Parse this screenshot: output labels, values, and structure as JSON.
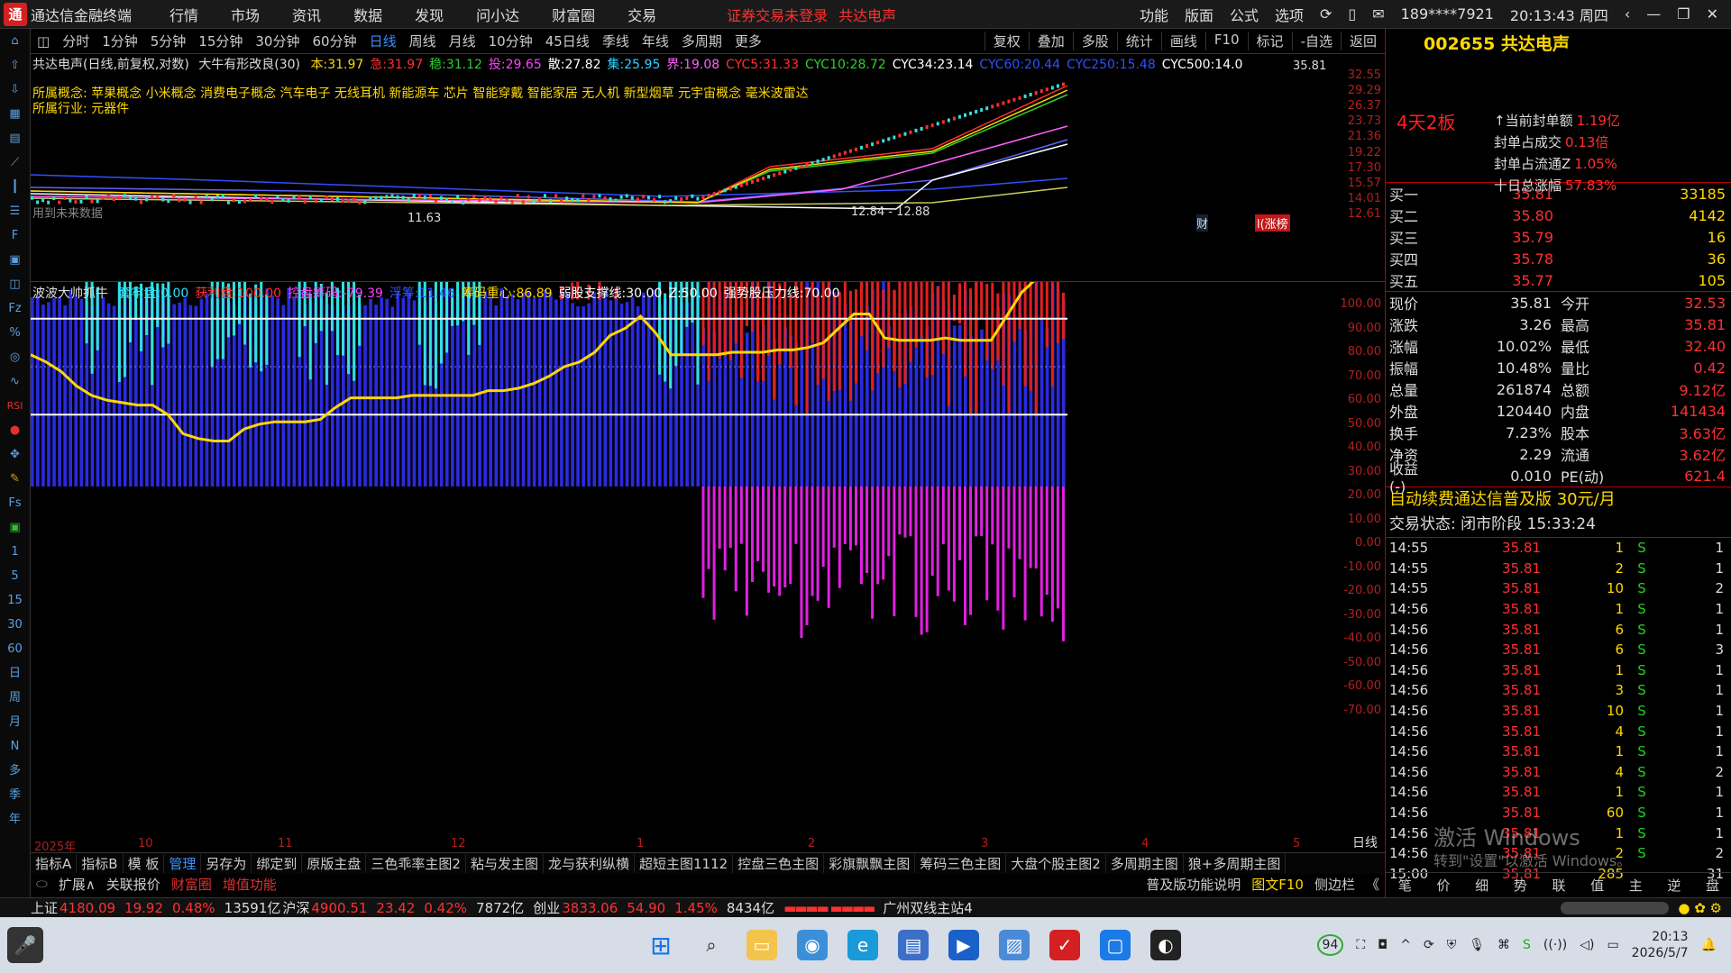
{
  "app": {
    "title": "通达信金融终端",
    "menu": [
      "行情",
      "市场",
      "资讯",
      "数据",
      "发现",
      "问小达",
      "财富圈",
      "交易"
    ],
    "alert": [
      "证券交易未登录",
      "共达电声"
    ],
    "right_menu": [
      "功能",
      "版面",
      "公式",
      "选项"
    ],
    "account": "189****7921",
    "time": "20:13:43 周四"
  },
  "periods": [
    "分时",
    "1分钟",
    "5分钟",
    "15分钟",
    "30分钟",
    "60分钟",
    "日线",
    "周线",
    "月线",
    "10分钟",
    "45日线",
    "季线",
    "年线",
    "多周期",
    "更多"
  ],
  "period_selected": "日线",
  "toolbar": [
    "复权",
    "叠加",
    "多股",
    "统计",
    "画线",
    "F10",
    "标记",
    "-自选",
    "返回"
  ],
  "stock": {
    "code": "002655",
    "name": "共达电声",
    "header_line": "共达电声(日线,前复权,对数)",
    "indicator_name": "大牛有形改良(30)",
    "header_values": [
      {
        "label": "本:",
        "value": "31.97",
        "color": "#ffd800"
      },
      {
        "label": "急:",
        "value": "31.97",
        "color": "#ff3030"
      },
      {
        "label": "稳:",
        "value": "31.12",
        "color": "#30d030"
      },
      {
        "label": "投:",
        "value": "29.65",
        "color": "#ff40ff"
      },
      {
        "label": "散:",
        "value": "27.82",
        "color": "#ffffff"
      },
      {
        "label": "集:",
        "value": "25.95",
        "color": "#30d0ff"
      },
      {
        "label": "界:",
        "value": "19.08",
        "color": "#ff60ff"
      },
      {
        "label": "CYC5:",
        "value": "31.33",
        "color": "#ff3030"
      },
      {
        "label": "CYC10:",
        "value": "28.72",
        "color": "#30d030"
      },
      {
        "label": "CYC34:",
        "value": "23.14",
        "color": "#ffffff"
      },
      {
        "label": "CYC60:",
        "value": "20.44",
        "color": "#3050ff"
      },
      {
        "label": "CYC250:",
        "value": "15.48",
        "color": "#3050ff"
      },
      {
        "label": "CYC500:",
        "value": "14.0",
        "color": "#ffffff"
      }
    ],
    "concepts": "所属概念: 苹果概念 小米概念 消费电子概念 汽车电子 无线耳机 新能源车 芯片 智能穿戴 智能家居 无人机 新型烟草 元宇宙概念 毫米波雷达",
    "industry": "所属行业: 元器件",
    "future_note": "用到未来数据",
    "low_label": "11.63",
    "range_label": "12.84 - 12.88",
    "high_label": "35.81",
    "tags": [
      "财",
      "l(涨榜"
    ]
  },
  "price_axis": [
    "32.55",
    "29.29",
    "26.37",
    "23.73",
    "21.36",
    "19.22",
    "17.30",
    "15.57",
    "14.01",
    "12.61"
  ],
  "indicator": {
    "name": "波波大帅抓牛",
    "values": [
      {
        "label": "套牢盘:",
        "value": "0.00",
        "color": "#30e0ff"
      },
      {
        "label": "获利盘:",
        "value": "100.00",
        "color": "#ff3030"
      },
      {
        "label": "控盘筹码:",
        "value": "-79.39",
        "color": "#ff40ff"
      },
      {
        "label": "浮筹:",
        "value": "11.46",
        "color": "#3050ff"
      },
      {
        "label": "筹码重心:",
        "value": "86.89",
        "color": "#ffd800"
      },
      {
        "label": "弱股支撑线:",
        "value": "30.00",
        "color": "#ffffff"
      },
      {
        "label": "Z:",
        "value": "50.00",
        "color": "#ffffff"
      },
      {
        "label": "强势股压力线:",
        "value": "70.00",
        "color": "#ffffff"
      }
    ],
    "axis": [
      "100.00",
      "90.00",
      "80.00",
      "70.00",
      "60.00",
      "50.00",
      "40.00",
      "30.00",
      "20.00",
      "10.00",
      "0.00",
      "-10.00",
      "-20.00",
      "-30.00",
      "-40.00",
      "-50.00",
      "-60.00",
      "-70.00"
    ]
  },
  "date_axis": [
    "2025年",
    "10",
    "11",
    "12",
    "1",
    "2",
    "3",
    "4",
    "5"
  ],
  "date_mode": "日线",
  "template_tabs": [
    "指标A",
    "指标B",
    "模 板",
    "管理",
    "另存为",
    "绑定到",
    "原版主盘",
    "三色乖率主图2",
    "粘与发主图",
    "龙与获利纵横",
    "超短主图1112",
    "控盘三色主图",
    "彩旗飘飘主图",
    "筹码三色主图",
    "大盘个股主图2",
    "多周期主图",
    "狼+多周期主图"
  ],
  "tab_selected": "管理",
  "sub_tabs": [
    "扩展∧",
    "关联报价",
    "财富圈",
    "增值功能"
  ],
  "sub_right": [
    "普及版功能说明",
    "图文F10",
    "侧边栏",
    "《"
  ],
  "panel": {
    "title": "002655 共达电声",
    "badge": "4天2板",
    "info": [
      {
        "k": "↑当前封单额",
        "v": "1.19亿"
      },
      {
        "k": "封单占成交",
        "v": "0.13倍"
      },
      {
        "k": "封单占流通Z",
        "v": "1.05%"
      },
      {
        "k": "十日总涨幅",
        "v": "57.83%"
      }
    ],
    "bids": [
      {
        "l": "买一",
        "p": "35.81",
        "v": "33185"
      },
      {
        "l": "买二",
        "p": "35.80",
        "v": "4142"
      },
      {
        "l": "买三",
        "p": "35.79",
        "v": "16"
      },
      {
        "l": "买四",
        "p": "35.78",
        "v": "36"
      },
      {
        "l": "买五",
        "p": "35.77",
        "v": "105"
      }
    ],
    "quotes": [
      {
        "k": "现价",
        "a": "35.81",
        "k2": "今开",
        "b": "32.53"
      },
      {
        "k": "涨跌",
        "a": "3.26",
        "k2": "最高",
        "b": "35.81"
      },
      {
        "k": "涨幅",
        "a": "10.02%",
        "k2": "最低",
        "b": "32.40"
      },
      {
        "k": "振幅",
        "a": "10.48%",
        "k2": "量比",
        "b": "0.42"
      },
      {
        "k": "总量",
        "a": "261874",
        "k2": "总额",
        "b": "9.12亿"
      },
      {
        "k": "外盘",
        "a": "120440",
        "k2": "内盘",
        "b": "141434"
      },
      {
        "k": "换手",
        "a": "7.23%",
        "k2": "股本",
        "b": "3.63亿"
      },
      {
        "k": "净资",
        "a": "2.29",
        "k2": "流通",
        "b": "3.62亿"
      },
      {
        "k": "收益(-)",
        "a": "0.010",
        "k2": "PE(动)",
        "b": "621.4"
      }
    ],
    "ad": "自动续费通达信普及版",
    "ad_price": "30元/月",
    "state_label": "交易状态: 闭市阶段",
    "state_time": "15:33:24",
    "ticks": [
      {
        "t": "14:55",
        "p": "35.81",
        "q": "1",
        "s": "S",
        "n": "1"
      },
      {
        "t": "14:55",
        "p": "35.81",
        "q": "2",
        "s": "S",
        "n": "1"
      },
      {
        "t": "14:55",
        "p": "35.81",
        "q": "10",
        "s": "S",
        "n": "2"
      },
      {
        "t": "14:56",
        "p": "35.81",
        "q": "1",
        "s": "S",
        "n": "1"
      },
      {
        "t": "14:56",
        "p": "35.81",
        "q": "6",
        "s": "S",
        "n": "1"
      },
      {
        "t": "14:56",
        "p": "35.81",
        "q": "6",
        "s": "S",
        "n": "3"
      },
      {
        "t": "14:56",
        "p": "35.81",
        "q": "1",
        "s": "S",
        "n": "1"
      },
      {
        "t": "14:56",
        "p": "35.81",
        "q": "3",
        "s": "S",
        "n": "1"
      },
      {
        "t": "14:56",
        "p": "35.81",
        "q": "10",
        "s": "S",
        "n": "1"
      },
      {
        "t": "14:56",
        "p": "35.81",
        "q": "4",
        "s": "S",
        "n": "1"
      },
      {
        "t": "14:56",
        "p": "35.81",
        "q": "1",
        "s": "S",
        "n": "1"
      },
      {
        "t": "14:56",
        "p": "35.81",
        "q": "4",
        "s": "S",
        "n": "2"
      },
      {
        "t": "14:56",
        "p": "35.81",
        "q": "1",
        "s": "S",
        "n": "1"
      },
      {
        "t": "14:56",
        "p": "35.81",
        "q": "60",
        "s": "S",
        "n": "1"
      },
      {
        "t": "14:56",
        "p": "35.81",
        "q": "1",
        "s": "S",
        "n": "1"
      },
      {
        "t": "14:56",
        "p": "35.81",
        "q": "2",
        "s": "S",
        "n": "2"
      },
      {
        "t": "15:00",
        "p": "35.81",
        "q": "285",
        "s": "",
        "n": "31"
      }
    ],
    "bottom_tabs": [
      "笔",
      "价",
      "细",
      "势",
      "联",
      "值",
      "主",
      "逆",
      "盘"
    ]
  },
  "status": {
    "sh_label": "上证",
    "sh_val": "4180.09",
    "sh_chg": "19.92",
    "sh_pct": "0.48%",
    "sh_amt": "13591亿",
    "hs_label": "沪深",
    "hs_val": "4900.51",
    "hs_chg": "23.42",
    "hs_pct": "0.42%",
    "hs_amt": "7872亿",
    "cy_label": "创业",
    "cy_val": "3833.06",
    "cy_chg": "54.90",
    "cy_pct": "1.45%",
    "cy_amt": "8434亿",
    "server": "广州双线主站4"
  },
  "taskbar": {
    "time": "20:13",
    "date": "2026/5/7",
    "badge": "94"
  },
  "watermark": {
    "line1": "激活 Windows",
    "line2": "转到\"设置\"以激活 Windows。"
  }
}
